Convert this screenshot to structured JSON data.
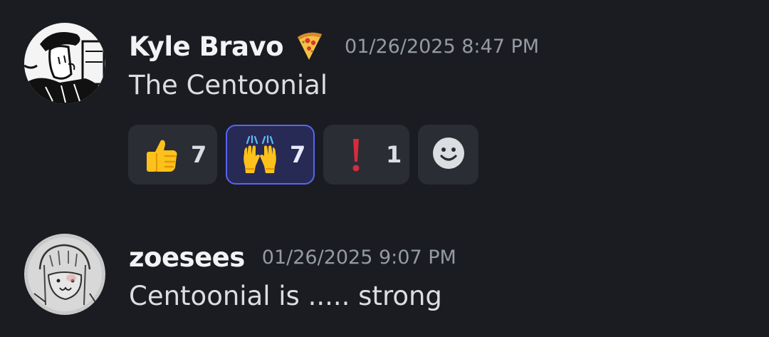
{
  "messages": [
    {
      "username": "Kyle Bravo",
      "role_icon": "pizza-icon",
      "timestamp": "01/26/2025 8:47 PM",
      "content": "The Centoonial",
      "reactions": [
        {
          "emoji": "thumbs-up-icon",
          "count": "7",
          "active": false
        },
        {
          "emoji": "raising-hands-icon",
          "count": "7",
          "active": true
        },
        {
          "emoji": "exclamation-mark-icon",
          "count": "1",
          "active": false
        }
      ],
      "add_reaction_icon": "smiley-add-reaction-icon"
    },
    {
      "username": "zoesees",
      "timestamp": "01/26/2025 9:07 PM",
      "content": "Centoonial is ..... strong"
    }
  ],
  "colors": {
    "background": "#1b1c21",
    "reaction_bg": "#2b2d35",
    "reaction_active_bg": "#262a55",
    "reaction_active_border": "#5865f2",
    "username": "#f2f3f5",
    "timestamp": "#949ba4",
    "text": "#dbdee1"
  }
}
